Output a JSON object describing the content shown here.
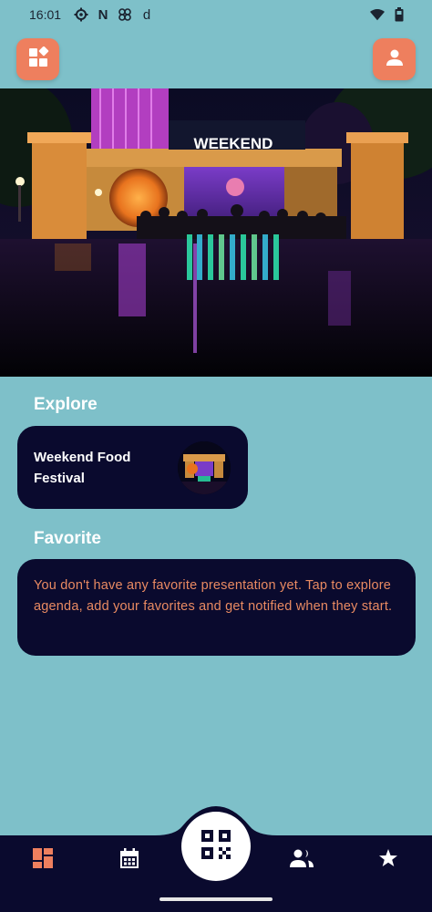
{
  "status_bar": {
    "time": "16:01",
    "left_icons": [
      "settings-cog-icon",
      "netflix-n-icon",
      "pinwheel-icon",
      "d-letter-icon"
    ],
    "n_glyph": "N",
    "d_glyph": "d",
    "right_icons": [
      "wifi-icon",
      "battery-icon"
    ]
  },
  "header": {
    "left_button_icon": "dashboard-shapes-icon",
    "right_button_icon": "user-profile-icon"
  },
  "hero": {
    "sign_text": "WEEKEND"
  },
  "explore": {
    "title": "Explore",
    "card_title": "Weekend Food Festival"
  },
  "favorite": {
    "title": "Favorite",
    "empty_message": "You don't have any favorite presentation yet. Tap to explore agenda, add your favorites and get notified when they start."
  },
  "bottom_nav": {
    "items": [
      "dashboard-icon",
      "calendar-icon",
      "qr-code-icon",
      "people-icon",
      "star-icon"
    ],
    "active": "dashboard-icon"
  },
  "colors": {
    "background": "#7ec0c9",
    "accent": "#ee7f5e",
    "card": "#0a0a2e",
    "favorite_text": "#e98a62"
  }
}
